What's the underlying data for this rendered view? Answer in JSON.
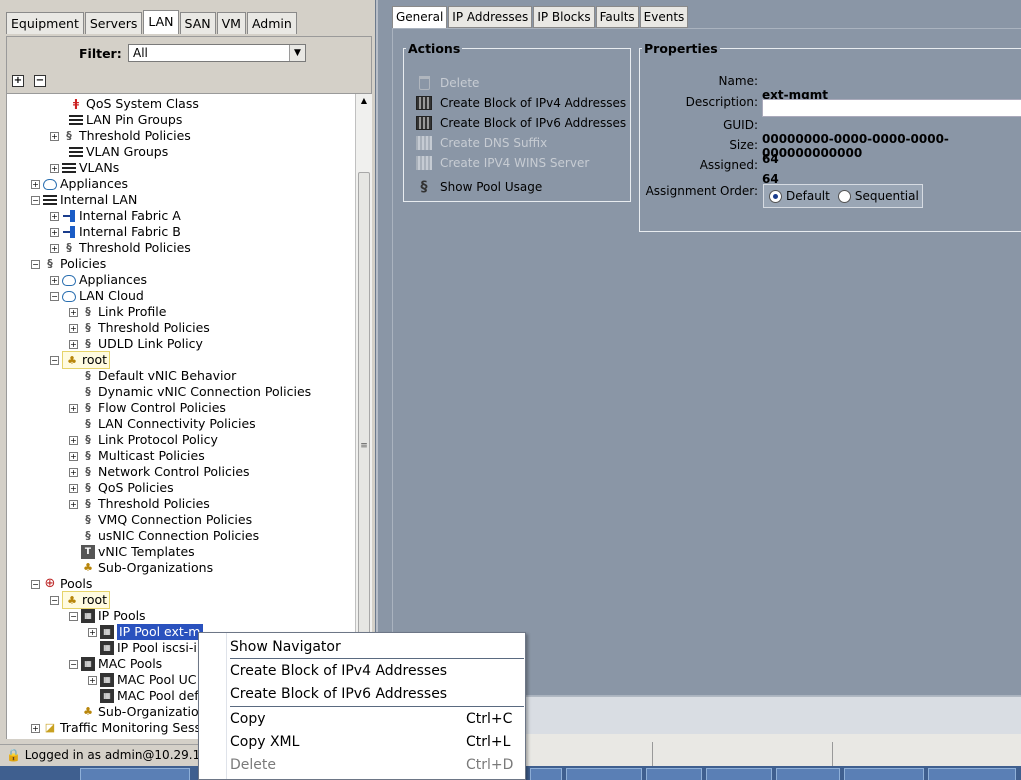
{
  "nav_tabs": [
    {
      "label": "Equipment",
      "active": false
    },
    {
      "label": "Servers",
      "active": false
    },
    {
      "label": "LAN",
      "active": true
    },
    {
      "label": "SAN",
      "active": false
    },
    {
      "label": "VM",
      "active": false
    },
    {
      "label": "Admin",
      "active": false
    }
  ],
  "filter": {
    "label": "Filter:",
    "value": "All"
  },
  "tree_toolbar": {
    "expand": "+",
    "collapse": "−"
  },
  "tree": {
    "qos_system_class": "QoS System Class",
    "lan_pin_groups": "LAN Pin Groups",
    "threshold_policies_1": "Threshold Policies",
    "vlan_groups": "VLAN Groups",
    "vlans": "VLANs",
    "appliances": "Appliances",
    "internal_lan": "Internal LAN",
    "internal_fabric_a": "Internal Fabric A",
    "internal_fabric_b": "Internal Fabric B",
    "threshold_policies_2": "Threshold Policies",
    "policies": "Policies",
    "policies_appliances": "Appliances",
    "lan_cloud": "LAN Cloud",
    "link_profile": "Link Profile",
    "threshold_policies_3": "Threshold Policies",
    "udld_link_policy": "UDLD Link Policy",
    "root_1": "root",
    "default_vnic_behavior": "Default vNIC Behavior",
    "dynamic_vnic_connection_policies": "Dynamic vNIC Connection Policies",
    "flow_control_policies": "Flow Control Policies",
    "lan_connectivity_policies": "LAN Connectivity Policies",
    "link_protocol_policy": "Link Protocol Policy",
    "multicast_policies": "Multicast Policies",
    "network_control_policies": "Network Control Policies",
    "qos_policies": "QoS Policies",
    "threshold_policies_4": "Threshold Policies",
    "vmq_connection_policies": "VMQ Connection Policies",
    "usnic_connection_policies": "usNIC Connection Policies",
    "vnic_templates": "vNIC Templates",
    "sub_organizations_1": "Sub-Organizations",
    "pools": "Pools",
    "root_2": "root",
    "ip_pools": "IP Pools",
    "ip_pool_ext_mgmt": "IP Pool ext-m",
    "ip_pool_iscsi": "IP Pool iscsi-i",
    "mac_pools": "MAC Pools",
    "mac_pool_uc": "MAC Pool UC",
    "mac_pool_def": "MAC Pool def",
    "sub_organizations_2": "Sub-Organization",
    "traffic_monitoring": "Traffic Monitoring Sess"
  },
  "status_bar": {
    "text": "Logged in as admin@10.29.16"
  },
  "right_tabs": [
    {
      "label": "General",
      "active": true
    },
    {
      "label": "IP Addresses",
      "active": false
    },
    {
      "label": "IP Blocks",
      "active": false
    },
    {
      "label": "Faults",
      "active": false
    },
    {
      "label": "Events",
      "active": false
    }
  ],
  "actions": {
    "title": "Actions",
    "items": [
      {
        "label": "Delete",
        "enabled": false,
        "icon": "trash-icon"
      },
      {
        "label": "Create Block of IPv4 Addresses",
        "enabled": true,
        "icon": "block-icon"
      },
      {
        "label": "Create Block of IPv6 Addresses",
        "enabled": true,
        "icon": "block-icon"
      },
      {
        "label": "Create DNS Suffix",
        "enabled": false,
        "icon": "block-icon"
      },
      {
        "label": "Create IPV4 WINS Server",
        "enabled": false,
        "icon": "block-icon"
      },
      {
        "label": "Show Pool Usage",
        "enabled": true,
        "icon": "policy-icon"
      }
    ]
  },
  "properties": {
    "title": "Properties",
    "name_label": "Name:",
    "name_value": "ext-mgmt",
    "description_label": "Description:",
    "description_value": "",
    "guid_label": "GUID:",
    "guid_value": "00000000-0000-0000-0000-000000000000",
    "size_label": "Size:",
    "size_value": "64",
    "assigned_label": "Assigned:",
    "assigned_value": "64",
    "assignment_order_label": "Assignment Order:",
    "assignment_order_options": [
      "Default",
      "Sequential"
    ],
    "assignment_order_selected": "Default"
  },
  "context_menu": {
    "items": [
      {
        "label": "Show Navigator",
        "shortcut": "",
        "enabled": true
      },
      {
        "label": "Create Block of IPv4 Addresses",
        "shortcut": "",
        "enabled": true
      },
      {
        "label": "Create Block of IPv6 Addresses",
        "shortcut": "",
        "enabled": true
      },
      {
        "label": "Copy",
        "shortcut": "Ctrl+C",
        "enabled": true
      },
      {
        "label": "Copy XML",
        "shortcut": "Ctrl+L",
        "enabled": true
      },
      {
        "label": "Delete",
        "shortcut": "Ctrl+D",
        "enabled": false
      }
    ]
  }
}
